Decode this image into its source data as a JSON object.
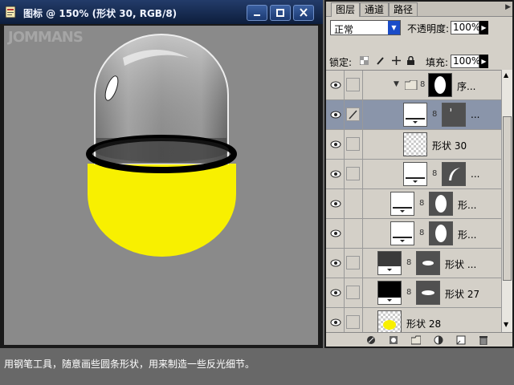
{
  "document": {
    "title": "图标 @ 150% (形状 30, RGB/8)",
    "watermark": "JOMMANS"
  },
  "layers_panel": {
    "tabs": [
      "图层",
      "通道",
      "路径"
    ],
    "blend_mode": "正常",
    "opacity_label": "不透明度:",
    "opacity_value": "100%",
    "lock_label": "锁定:",
    "fill_label": "填充:",
    "fill_value": "100%",
    "layers": [
      {
        "name": "序...",
        "type": "group",
        "selected": false
      },
      {
        "name": "...",
        "type": "shape-mask",
        "selected": true
      },
      {
        "name": "形状 30",
        "type": "checker",
        "selected": false
      },
      {
        "name": "...",
        "type": "shape-mask",
        "selected": false
      },
      {
        "name": "形...",
        "type": "shape-mask",
        "selected": false
      },
      {
        "name": "形...",
        "type": "shape-mask",
        "selected": false
      },
      {
        "name": "形状 ...",
        "type": "shape-dark",
        "selected": false
      },
      {
        "name": "形状 27",
        "type": "shape-black",
        "selected": false
      },
      {
        "name": "形状 28",
        "type": "checker-yellow",
        "selected": false
      }
    ]
  },
  "caption": "用钢笔工具，随意画些圆条形状，用来制造一些反光细节。",
  "colors": {
    "capsule_yellow": "#f8f000",
    "selection": "#8a95aa",
    "title_bar": "#1c3566"
  }
}
